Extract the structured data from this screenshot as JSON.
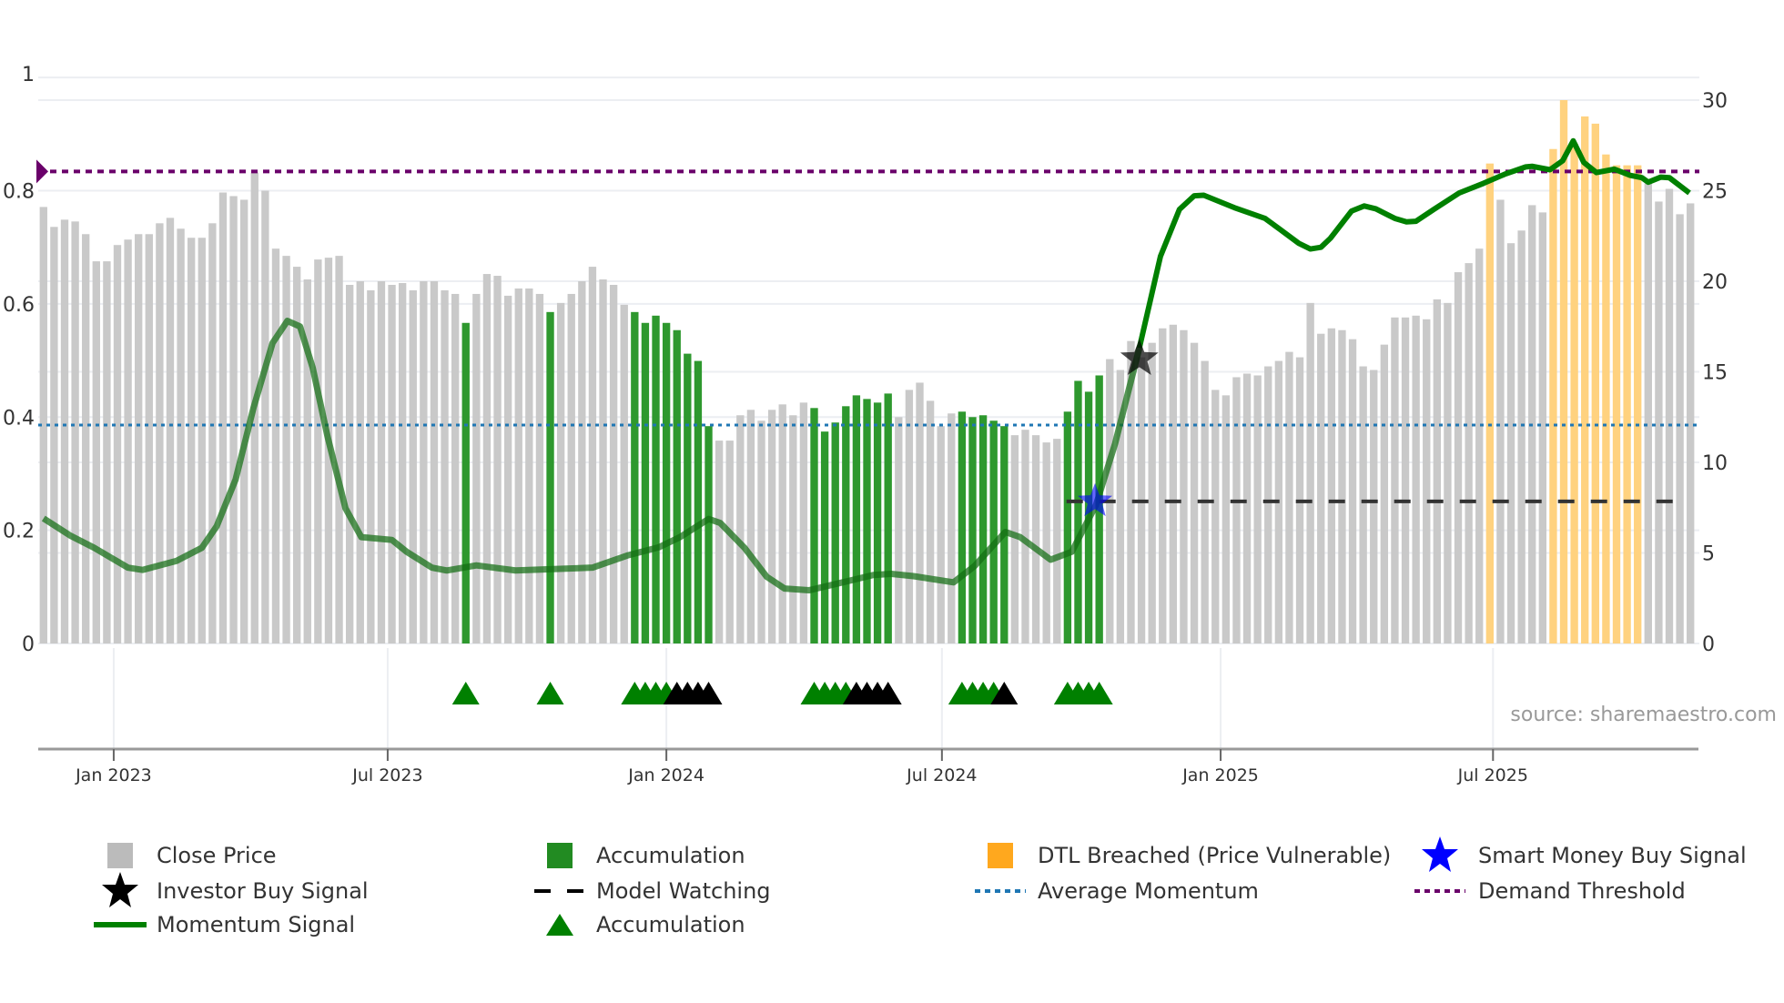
{
  "chart_data": {
    "type": "bar",
    "title": "",
    "source": "source: sharemaestro.com",
    "x_unit": "week index",
    "xticks": [
      {
        "label": "Jan 2023",
        "week": 6.65
      },
      {
        "label": "Jul 2023",
        "week": 32.6
      },
      {
        "label": "Jan 2024",
        "week": 59.0
      },
      {
        "label": "Jul 2024",
        "week": 85.1
      },
      {
        "label": "Jan 2025",
        "week": 111.5
      },
      {
        "label": "Jul 2025",
        "week": 137.3
      }
    ],
    "yaxis_left": {
      "range": [
        0,
        1
      ],
      "ticks": [
        "0",
        "0.2",
        "0.4",
        "0.6",
        "0.8",
        "1"
      ],
      "tick_values": [
        0,
        0.2,
        0.4,
        0.6,
        0.8,
        1
      ]
    },
    "yaxis_right": {
      "range": [
        0,
        31.25
      ],
      "ticks": [
        "0",
        "5",
        "10",
        "15",
        "20",
        "25",
        "30"
      ],
      "tick_values": [
        0,
        5,
        10,
        15,
        20,
        25,
        30
      ]
    },
    "close_price": [
      24.1,
      23.0,
      23.4,
      23.3,
      22.6,
      21.1,
      21.1,
      22.0,
      22.3,
      22.6,
      22.6,
      23.2,
      23.5,
      22.9,
      22.4,
      22.4,
      23.2,
      24.9,
      24.7,
      24.5,
      26.0,
      25.0,
      21.8,
      21.4,
      20.8,
      20.1,
      21.2,
      21.3,
      21.4,
      19.8,
      20.0,
      19.5,
      20.0,
      19.8,
      19.9,
      19.5,
      20.0,
      20.0,
      19.5,
      19.3,
      17.7,
      19.3,
      20.4,
      20.3,
      19.2,
      19.6,
      19.6,
      19.3,
      18.3,
      18.8,
      19.3,
      20.0,
      20.8,
      20.1,
      19.8,
      18.7,
      18.3,
      17.7,
      18.1,
      17.7,
      17.3,
      16.0,
      15.6,
      12.0,
      11.2,
      11.2,
      12.6,
      12.9,
      12.3,
      12.9,
      13.2,
      12.6,
      13.3,
      13.0,
      11.7,
      12.2,
      13.1,
      13.7,
      13.5,
      13.3,
      13.8,
      12.5,
      14.0,
      14.4,
      13.4,
      12.0,
      12.7,
      12.8,
      12.5,
      12.6,
      12.3,
      12.0,
      11.5,
      11.8,
      11.5,
      11.1,
      11.3,
      12.8,
      14.5,
      13.9,
      14.8,
      15.7,
      15.1,
      16.7,
      15.8,
      16.6,
      17.4,
      17.6,
      17.3,
      16.6,
      15.6,
      14.0,
      13.7,
      14.7,
      14.9,
      14.8,
      15.3,
      15.6,
      16.1,
      15.8,
      18.8,
      17.1,
      17.4,
      17.3,
      16.8,
      15.3,
      15.1,
      16.5,
      18.0,
      18.0,
      18.1,
      17.9,
      19.0,
      18.8,
      20.5,
      21.0,
      21.8,
      26.5,
      24.5,
      22.1,
      22.8,
      24.2,
      23.8,
      27.3,
      30.0,
      27.6,
      29.1,
      28.7,
      27.0,
      26.4,
      26.4,
      26.4,
      25.4,
      24.4,
      25.1,
      23.7,
      24.3
    ],
    "accumulation_weeks": [
      40,
      48,
      56,
      57,
      58,
      59,
      60,
      61,
      62,
      63,
      73,
      74,
      75,
      76,
      77,
      78,
      79,
      80,
      87,
      88,
      89,
      90,
      91,
      97,
      98,
      99,
      100
    ],
    "dtl_breached_weeks": [
      137,
      143,
      144,
      145,
      146,
      147,
      148,
      149,
      150,
      151
    ],
    "accumulation_markers_green": [
      40,
      48,
      56,
      57,
      58,
      59,
      73,
      74,
      75,
      76,
      87,
      88,
      89,
      90,
      97,
      98,
      99,
      100
    ],
    "accumulation_markers_black": [
      60,
      61,
      62,
      63,
      77,
      78,
      79,
      80,
      91
    ],
    "momentum_signal": [
      [
        0,
        0.221
      ],
      [
        2.5,
        0.191
      ],
      [
        4.8,
        0.169
      ],
      [
        8,
        0.134
      ],
      [
        9.4,
        0.13
      ],
      [
        12.6,
        0.146
      ],
      [
        15,
        0.169
      ],
      [
        16.4,
        0.207
      ],
      [
        18.2,
        0.29
      ],
      [
        19.9,
        0.417
      ],
      [
        21.7,
        0.531
      ],
      [
        23.1,
        0.57
      ],
      [
        24.3,
        0.56
      ],
      [
        25.5,
        0.487
      ],
      [
        26.9,
        0.366
      ],
      [
        28.6,
        0.239
      ],
      [
        30.1,
        0.188
      ],
      [
        33,
        0.183
      ],
      [
        34.4,
        0.162
      ],
      [
        36.8,
        0.134
      ],
      [
        38.2,
        0.129
      ],
      [
        41,
        0.138
      ],
      [
        44.7,
        0.129
      ],
      [
        52,
        0.134
      ],
      [
        55.4,
        0.156
      ],
      [
        58.3,
        0.17
      ],
      [
        60.3,
        0.188
      ],
      [
        63,
        0.22
      ],
      [
        64.1,
        0.213
      ],
      [
        66.4,
        0.169
      ],
      [
        68.5,
        0.118
      ],
      [
        70.2,
        0.097
      ],
      [
        72.5,
        0.094
      ],
      [
        75.7,
        0.108
      ],
      [
        78.6,
        0.121
      ],
      [
        80.3,
        0.123
      ],
      [
        82.4,
        0.119
      ],
      [
        86.2,
        0.108
      ],
      [
        88.2,
        0.137
      ],
      [
        91.1,
        0.197
      ],
      [
        92.5,
        0.188
      ],
      [
        95.4,
        0.148
      ],
      [
        97.4,
        0.162
      ],
      [
        99.7,
        0.245
      ],
      [
        101.5,
        0.353
      ],
      [
        103.8,
        0.522
      ],
      [
        105.8,
        0.684
      ],
      [
        107.6,
        0.767
      ],
      [
        109,
        0.791
      ],
      [
        109.9,
        0.792
      ],
      [
        112.8,
        0.77
      ],
      [
        115.7,
        0.751
      ],
      [
        117.1,
        0.732
      ],
      [
        118.9,
        0.707
      ],
      [
        120,
        0.697
      ],
      [
        121,
        0.7
      ],
      [
        121.9,
        0.716
      ],
      [
        123.9,
        0.764
      ],
      [
        125.1,
        0.773
      ],
      [
        126.2,
        0.768
      ],
      [
        128,
        0.751
      ],
      [
        129.1,
        0.745
      ],
      [
        130,
        0.746
      ],
      [
        131.7,
        0.767
      ],
      [
        134.1,
        0.796
      ],
      [
        136.4,
        0.813
      ],
      [
        138.4,
        0.829
      ],
      [
        140.4,
        0.842
      ],
      [
        141,
        0.843
      ],
      [
        142.7,
        0.837
      ],
      [
        143.9,
        0.853
      ],
      [
        144.9,
        0.888
      ],
      [
        145.9,
        0.85
      ],
      [
        147.1,
        0.832
      ],
      [
        148.8,
        0.838
      ],
      [
        150.3,
        0.827
      ],
      [
        151.4,
        0.823
      ],
      [
        152,
        0.815
      ],
      [
        153.2,
        0.824
      ],
      [
        154,
        0.823
      ],
      [
        155.9,
        0.796
      ]
    ],
    "momentum_solid_from_week": 103.8,
    "average_momentum": 0.386,
    "demand_threshold": 0.834,
    "model_watching": {
      "value": 0.251,
      "from_week": 96.9,
      "to_week": 155.5
    },
    "smart_money_buy_signal": {
      "week": 99.6,
      "value": 0.251
    },
    "investor_buy_signal": {
      "week": 103.8,
      "value": 0.503
    },
    "colors": {
      "close": "#c9c9c9",
      "close_legend": "#bbbbbb",
      "accumulation": "#2e982e",
      "accumulation_legend": "#228b22",
      "dtl": "#ffd27f",
      "dtl_legend": "#ffa81e",
      "momentum": "#008000",
      "avg": "#1f77b4",
      "demand": "#6a006a",
      "smart_star": "#0000ff",
      "investor_star": "#000000"
    },
    "legend": [
      {
        "label": "Close Price"
      },
      {
        "label": "Accumulation"
      },
      {
        "label": "DTL Breached (Price Vulnerable)"
      },
      {
        "label": "Smart Money Buy Signal"
      },
      {
        "label": "Investor Buy Signal"
      },
      {
        "label": "Model Watching"
      },
      {
        "label": "Average Momentum"
      },
      {
        "label": "Demand Threshold"
      },
      {
        "label": "Momentum Signal"
      },
      {
        "label": "Accumulation"
      }
    ]
  }
}
